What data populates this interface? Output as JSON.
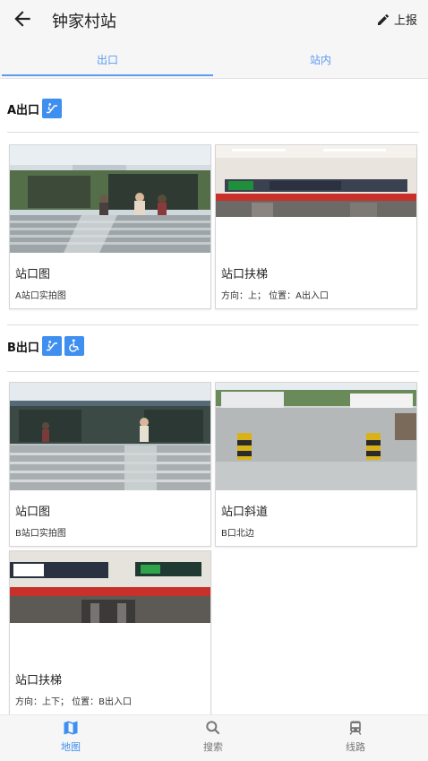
{
  "header": {
    "title": "钟家村站",
    "report_label": "上报"
  },
  "tabs": [
    {
      "label": "出口",
      "active": true
    },
    {
      "label": "站内",
      "active": false
    }
  ],
  "sections": [
    {
      "title": "A出口",
      "icons": [
        "escalator-icon"
      ],
      "cards": [
        {
          "title": "站口图",
          "subtitle": "A站口实拍图"
        },
        {
          "title": "站口扶梯",
          "subtitle": "方向：上； 位置：A出入口"
        }
      ]
    },
    {
      "title": "B出口",
      "icons": [
        "escalator-icon",
        "wheelchair-icon"
      ],
      "cards": [
        {
          "title": "站口图",
          "subtitle": "B站口实拍图"
        },
        {
          "title": "站口斜道",
          "subtitle": "B口北边"
        },
        {
          "title": "站口扶梯",
          "subtitle": "方向：上下； 位置：B出入口"
        }
      ]
    }
  ],
  "bottom_nav": [
    {
      "label": "地图",
      "icon": "map-icon",
      "active": true
    },
    {
      "label": "搜索",
      "icon": "search-icon",
      "active": false
    },
    {
      "label": "线路",
      "icon": "train-icon",
      "active": false
    }
  ],
  "colors": {
    "accent": "#3f8ff0",
    "tab_text": "#5d9bf2",
    "bar_bg": "#f6f6f6"
  }
}
